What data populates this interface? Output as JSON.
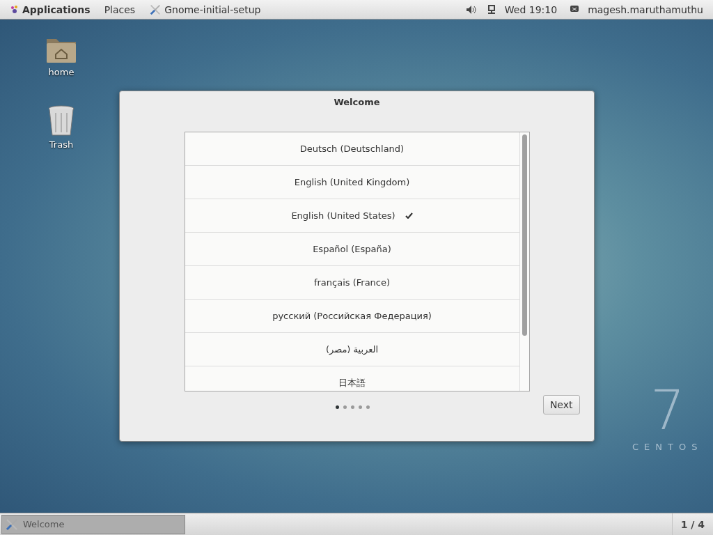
{
  "top_bar": {
    "menus": [
      {
        "label": "Applications",
        "kind": "apps"
      },
      {
        "label": "Places",
        "kind": "plain"
      },
      {
        "label": "Gnome-initial-setup",
        "kind": "app"
      }
    ],
    "clock": "Wed 19:10",
    "user": "magesh.maruthamuthu"
  },
  "desktop_icons": [
    {
      "label": "home",
      "kind": "folder"
    },
    {
      "label": "Trash",
      "kind": "trash"
    }
  ],
  "dialog": {
    "title": "Welcome",
    "languages": [
      {
        "label": "Deutsch (Deutschland)",
        "selected": false
      },
      {
        "label": "English (United Kingdom)",
        "selected": false
      },
      {
        "label": "English (United States)",
        "selected": true
      },
      {
        "label": "Español (España)",
        "selected": false
      },
      {
        "label": "français (France)",
        "selected": false
      },
      {
        "label": "русский (Российская Федерация)",
        "selected": false
      },
      {
        "label": "العربية (مصر)",
        "selected": false
      },
      {
        "label": "日本語",
        "selected": false
      }
    ],
    "pages": [
      {
        "selected": true
      },
      {
        "selected": false
      },
      {
        "selected": false
      },
      {
        "selected": false
      },
      {
        "selected": false
      }
    ],
    "next_button": "Next"
  },
  "branding": {
    "number": "7",
    "name": "CENTOS"
  },
  "taskbar": {
    "windows": [
      {
        "label": "Welcome",
        "selected": true
      }
    ],
    "workspace": "1 / 4"
  }
}
